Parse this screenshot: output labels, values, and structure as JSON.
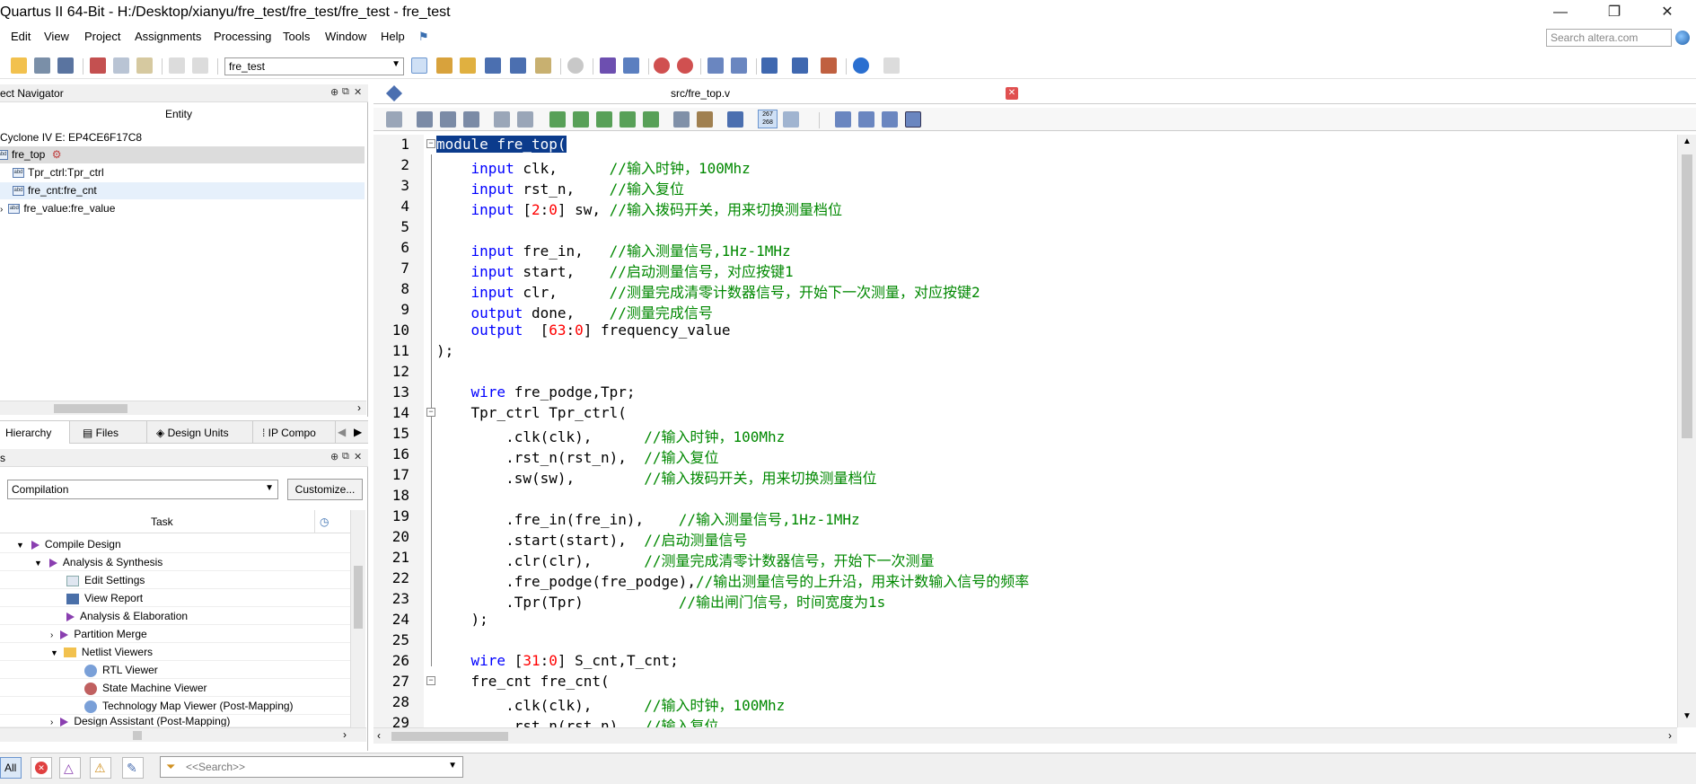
{
  "window": {
    "title": "Quartus II 64-Bit - H:/Desktop/xianyu/fre_test/fre_test/fre_test - fre_test"
  },
  "menu": [
    "Edit",
    "View",
    "Project",
    "Assignments",
    "Processing",
    "Tools",
    "Window",
    "Help"
  ],
  "search": {
    "placeholder": "Search altera.com"
  },
  "toolbar": {
    "project_value": "fre_test"
  },
  "navigator": {
    "title": "ect Navigator",
    "column": "Entity",
    "device": "Cyclone IV E: EP4CE6F17C8",
    "items": [
      "fre_top",
      "Tpr_ctrl:Tpr_ctrl",
      "fre_cnt:fre_cnt",
      "fre_value:fre_value"
    ],
    "tabs": [
      "Hierarchy",
      "Files",
      "Design Units",
      "IP Compo"
    ]
  },
  "tasks": {
    "title": "s",
    "flow": "Compilation",
    "customize_label": "Customize...",
    "column": "Task",
    "rows": [
      "Compile Design",
      "Analysis & Synthesis",
      "Edit Settings",
      "View Report",
      "Analysis & Elaboration",
      "Partition Merge",
      "Netlist Viewers",
      "RTL Viewer",
      "State Machine Viewer",
      "Technology Map Viewer (Post-Mapping)",
      "Design Assistant (Post-Mapping)"
    ]
  },
  "editor": {
    "tab_title": "src/fre_top.v",
    "toolbar_counter": "267\n268",
    "lines": [
      "1",
      "2",
      "3",
      "4",
      "5",
      "6",
      "7",
      "8",
      "9",
      "10",
      "11",
      "12",
      "13",
      "14",
      "15",
      "16",
      "17",
      "18",
      "19",
      "20",
      "21",
      "22",
      "23",
      "24",
      "25",
      "26",
      "27",
      "28",
      "29"
    ],
    "code": {
      "l1": "module fre_top(",
      "l2a": "    input",
      "l2b": " clk,      ",
      "l2c": "//输入时钟，100Mhz",
      "l3a": "    input",
      "l3b": " rst_n,    ",
      "l3c": "//输入复位",
      "l4a": "    input",
      "l4b": " [",
      "l4n1": "2",
      "l4col": ":",
      "l4n2": "0",
      "l4d": "] sw, ",
      "l4c": "//输入拨码开关，用来切换测量档位",
      "l6a": "    input",
      "l6b": " fre_in,   ",
      "l6c": "//输入测量信号,1Hz-1MHz",
      "l7a": "    input",
      "l7b": " start,    ",
      "l7c": "//启动测量信号，对应按键1",
      "l8a": "    input",
      "l8b": " clr,      ",
      "l8c": "//测量完成清零计数器信号，开始下一次测量，对应按键2",
      "l9a": "    output",
      "l9b": " done,    ",
      "l9c": "//测量完成信号",
      "l10a": "    output",
      "l10b": "  [",
      "l10n1": "63",
      "l10col": ":",
      "l10n2": "0",
      "l10d": "] frequency_value",
      "l11": ");",
      "l13a": "    wire",
      "l13b": " fre_podge,Tpr;",
      "l14": "    Tpr_ctrl Tpr_ctrl(",
      "l15a": "        .clk(clk),      ",
      "l15c": "//输入时钟，100Mhz",
      "l16a": "        .rst_n(rst_n),  ",
      "l16c": "//输入复位",
      "l17a": "        .sw(sw),        ",
      "l17c": "//输入拨码开关，用来切换测量档位",
      "l19a": "        .fre_in(fre_in),    ",
      "l19c": "//输入测量信号,1Hz-1MHz",
      "l20a": "        .start(start),  ",
      "l20c": "//启动测量信号",
      "l21a": "        .clr(clr),      ",
      "l21c": "//测量完成清零计数器信号，开始下一次测量",
      "l22a": "        .fre_podge(fre_podge),",
      "l22c": "//输出测量信号的上升沿，用来计数输入信号的频率",
      "l23a": "        .Tpr(Tpr)           ",
      "l23c": "//输出闸门信号，时间宽度为1s",
      "l24": "    );",
      "l26a": "    wire",
      "l26b": " [",
      "l26n1": "31",
      "l26col": ":",
      "l26n2": "0",
      "l26d": "] S_cnt,T_cnt;",
      "l27": "    fre_cnt fre_cnt(",
      "l28a": "        .clk(clk),      ",
      "l28c": "//输入时钟，100Mhz",
      "l29a": "        .rst_n(rst_n),  ",
      "l29c": "//输入复位"
    }
  },
  "messages": {
    "all_label": "All",
    "search_placeholder": "<<Search>>"
  },
  "colors": {
    "keyword": "#0000ff",
    "comment": "#008800",
    "number": "#ff0000",
    "selection": "#0b3b8c"
  }
}
